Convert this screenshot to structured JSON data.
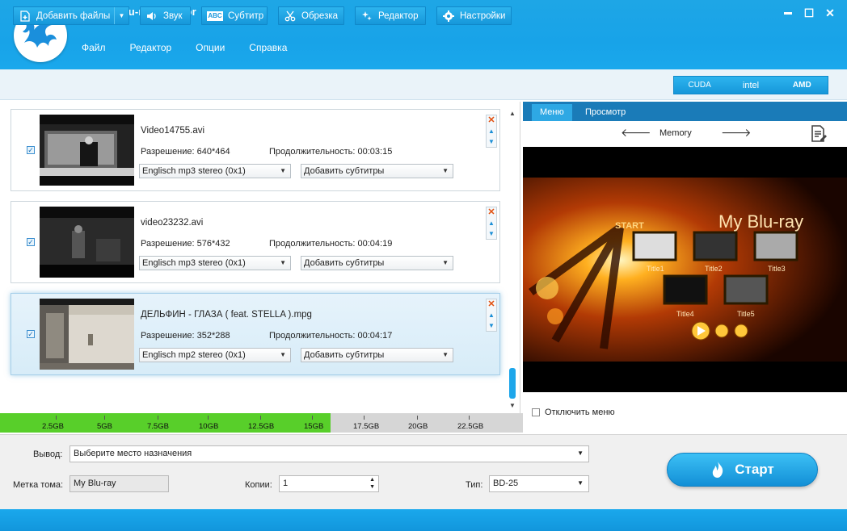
{
  "app": {
    "title": "AnyMP4 Blu-ray Creator",
    "menu": [
      "Файл",
      "Редактор",
      "Опции",
      "Справка"
    ],
    "window_controls": [
      "▬",
      "☐",
      "✕"
    ]
  },
  "toolbar": {
    "add_files": "Добавить файлы",
    "audio": "Звук",
    "subtitle": "Субтитр",
    "trim": "Обрезка",
    "editor": "Редактор",
    "settings": "Настройки",
    "accel": [
      "CUDA",
      "intel",
      "AMD"
    ],
    "subtitle_icon_text": "ABC"
  },
  "files": [
    {
      "name": "Video14755.avi",
      "resolution": "Разрешение:  640*464",
      "duration": "Продолжительность:  00:03:15",
      "audio": "Englisch mp3 stereo (0x1)",
      "subtitle": "Добавить субтитры",
      "checked": "✓"
    },
    {
      "name": "video23232.avi",
      "resolution": "Разрешение:  576*432",
      "duration": "Продолжительность:  00:04:19",
      "audio": "Englisch mp3 stereo (0x1)",
      "subtitle": "Добавить субтитры",
      "checked": "✓"
    },
    {
      "name": "ДЕЛЬФИН - ГЛАЗА ( feat. STELLA ).mpg",
      "resolution": "Разрешение:  352*288",
      "duration": "Продолжительность:  00:04:17",
      "audio": "Englisch mp2 stereo (0x1)",
      "subtitle": "Добавить субтитры",
      "checked": "✓"
    }
  ],
  "capacity": {
    "used_fraction": 0.632,
    "ticks": [
      "2.5GB",
      "5GB",
      "7.5GB",
      "10GB",
      "12.5GB",
      "15GB",
      "17.5GB",
      "20GB",
      "22.5GB"
    ]
  },
  "preview": {
    "tabs": [
      "Меню",
      "Просмотр"
    ],
    "template_name": "Memory",
    "menu_title": "My Blu-ray",
    "start_text": "START",
    "chapter_titles": [
      "Title1",
      "Title2",
      "Title3",
      "Title4",
      "Title5"
    ],
    "disable_menu_label": "Отключить меню"
  },
  "output": {
    "output_label": "Вывод:",
    "output_value": "Выберите место назначения",
    "volume_label": "Метка тома:",
    "volume_value": "My Blu-ray",
    "copies_label": "Копии:",
    "copies_value": "1",
    "type_label": "Тип:",
    "type_value": "BD-25",
    "start_button": "Старт"
  }
}
